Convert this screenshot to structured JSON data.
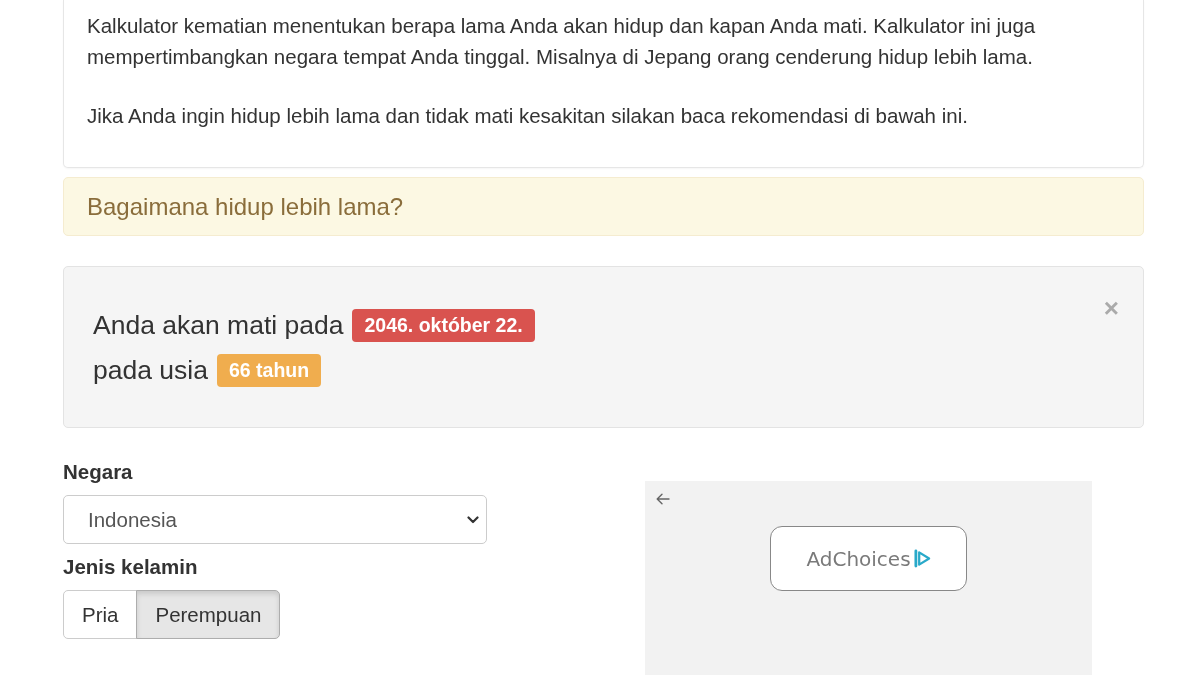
{
  "intro": {
    "paragraphs": [
      "Kalkulator kematian menentukan berapa lama Anda akan hidup dan kapan Anda mati. Kalkulator ini juga mempertimbangkan negara tempat Anda tinggal. Misalnya di Jepang orang cenderung hidup lebih lama.",
      "Jika Anda ingin hidup lebih lama dan tidak mati kesakitan silakan baca rekomendasi di bawah ini."
    ]
  },
  "tip_panel": {
    "title": "Bagaimana hidup lebih lama?"
  },
  "result": {
    "lines": [
      {
        "text": "Anda akan mati pada",
        "badge": "2046. október 22.",
        "color": "#d9534f"
      },
      {
        "text": "pada usia",
        "badge": "66 tahun",
        "color": "#f0ad4e"
      }
    ],
    "close": "×"
  },
  "form": {
    "fields": [
      {
        "kind": "select",
        "label": "Negara",
        "value": "Indonesia"
      },
      {
        "kind": "toggle",
        "label": "Jenis kelamin",
        "options": [
          {
            "label": "Pria",
            "selected": false
          },
          {
            "label": "Perempuan",
            "selected": true
          }
        ]
      }
    ]
  },
  "ad": {
    "label": "AdChoices"
  }
}
